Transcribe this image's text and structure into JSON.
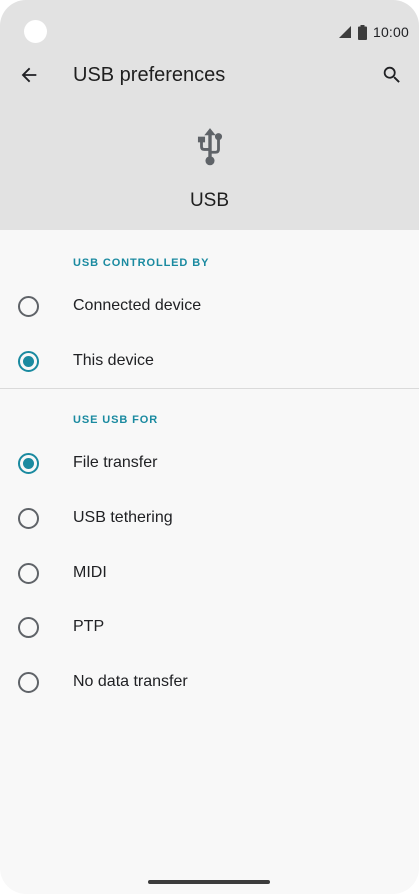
{
  "status_bar": {
    "time": "10:00"
  },
  "toolbar": {
    "title": "USB preferences"
  },
  "hero": {
    "label": "USB"
  },
  "sections": {
    "controlled_by": {
      "header": "USB CONTROLLED BY",
      "options": [
        {
          "label": "Connected device",
          "checked": false
        },
        {
          "label": "This device",
          "checked": true
        }
      ]
    },
    "use_for": {
      "header": "USE USB FOR",
      "options": [
        {
          "label": "File transfer",
          "checked": true
        },
        {
          "label": "USB tethering",
          "checked": false
        },
        {
          "label": "MIDI",
          "checked": false
        },
        {
          "label": "PTP",
          "checked": false
        },
        {
          "label": "No data transfer",
          "checked": false
        }
      ]
    }
  },
  "colors": {
    "accent": "#1a8aa0",
    "header_bg": "#e2e2e2",
    "page_bg": "#f8f8f8"
  },
  "icons": {
    "back": "arrow-back-icon",
    "search": "search-icon",
    "usb": "usb-icon",
    "signal": "signal-icon",
    "battery": "battery-icon"
  }
}
